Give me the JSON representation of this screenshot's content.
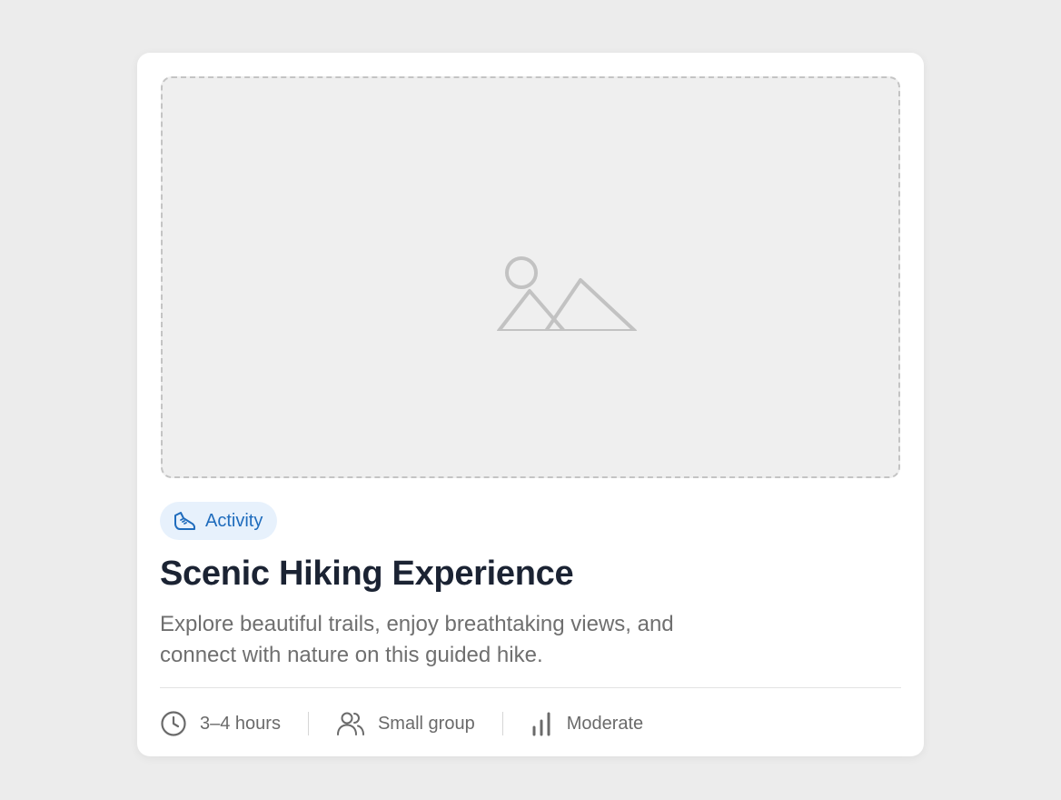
{
  "card": {
    "image_alt_icon": "image-placeholder-icon",
    "badge": {
      "icon": "shoe-icon",
      "label": "Activity",
      "color": "#1f6cbd",
      "background": "#e7f1fc"
    },
    "title": "Scenic Hiking Experience",
    "description": "Explore beautiful trails, enjoy breathtaking views, and connect with nature on this guided hike.",
    "meta": [
      {
        "icon": "clock-icon",
        "label": "3–4 hours"
      },
      {
        "icon": "group-icon",
        "label": "Small group"
      },
      {
        "icon": "difficulty-bars-icon",
        "label": "Moderate"
      }
    ]
  }
}
